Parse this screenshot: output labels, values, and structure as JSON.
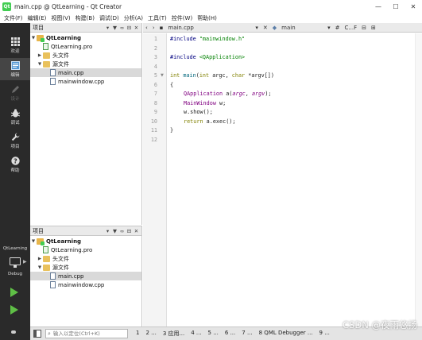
{
  "window": {
    "title": "main.cpp @ QtLearning - Qt Creator",
    "app_icon_letter": "Qt",
    "controls": {
      "minimize": "—",
      "maximize": "☐",
      "close": "✕"
    }
  },
  "menubar": {
    "items": [
      "文件(F)",
      "编辑(E)",
      "视图(V)",
      "构建(B)",
      "调试(D)",
      "分析(A)",
      "工具(T)",
      "控件(W)",
      "帮助(H)"
    ]
  },
  "modes": {
    "welcome": "欢迎",
    "edit": "编辑",
    "design": "设计",
    "debug": "调试",
    "projects": "项目",
    "help": "帮助"
  },
  "kit": {
    "project": "QtLearning",
    "config": "Debug"
  },
  "projects_pane_top": {
    "title": "项目",
    "root": "QtLearning",
    "pro_file": "QtLearning.pro",
    "headers_folder": "头文件",
    "sources_folder": "源文件",
    "files": [
      "main.cpp",
      "mainwindow.cpp"
    ],
    "selected_file": "main.cpp"
  },
  "projects_pane_bottom": {
    "title": "项目",
    "root": "QtLearning",
    "pro_file": "QtLearning.pro",
    "headers_folder": "头文件",
    "sources_folder": "源文件",
    "files": [
      "main.cpp",
      "mainwindow.cpp"
    ],
    "selected_file": "main.cpp"
  },
  "editor": {
    "open_file": "main.cpp",
    "symbol": "main",
    "hash": "#",
    "sym_short": "C...F",
    "line_numbers": [
      "1",
      "2",
      "3",
      "4",
      "5",
      "6",
      "7",
      "8",
      "9",
      "10",
      "11",
      "12"
    ],
    "code": {
      "l1_pre": "#include ",
      "l1_str": "\"mainwindow.h\"",
      "l3_pre": "#include ",
      "l3_str": "<QApplication>",
      "l5_kw1": "int",
      "l5_fn": " main",
      "l5_a": "(",
      "l5_kw2": "int",
      "l5_b": " argc, ",
      "l5_kw3": "char",
      "l5_c": " *argv[])",
      "l6": "{",
      "l7_type": "QApplication",
      "l7_a": " a(",
      "l7_arg1": "argc",
      "l7_b": ", ",
      "l7_arg2": "argv",
      "l7_c": ");",
      "l8_type": "MainWindow",
      "l8_a": " w;",
      "l9": "w.show();",
      "l10_kw": "return",
      "l10_a": " a.exec();",
      "l11": "}"
    }
  },
  "statusbar": {
    "locator_placeholder": "输入以定位(Ctrl+K)",
    "output_panes": [
      "1",
      "2 ...",
      "3 应用...",
      "4 ...",
      "5 ...",
      "6 ...",
      "7 ...",
      "8 QML Debugger ...",
      "9 ..."
    ]
  },
  "watermark": "CSDN @夜雨悠扬",
  "colors": {
    "sidebar_bg": "#2a2a2a",
    "run_green": "#5fbf46",
    "keyword": "#808000",
    "string": "#008000",
    "type": "#800080"
  }
}
